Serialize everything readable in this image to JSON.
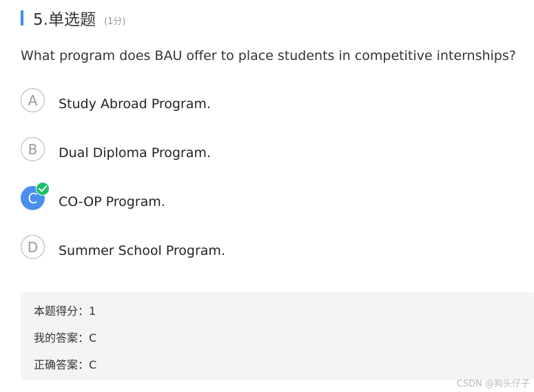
{
  "question": {
    "title": "5.单选题",
    "score_label": "(1分)",
    "stem": "What program does BAU offer to place students in competitive internships?"
  },
  "options": [
    {
      "letter": "A",
      "text": "Study Abroad Program.",
      "selected": false
    },
    {
      "letter": "B",
      "text": "Dual Diploma Program.",
      "selected": false
    },
    {
      "letter": "C",
      "text": "CO-OP Program.",
      "selected": true,
      "correct_badge_icon": "checkmark-icon"
    },
    {
      "letter": "D",
      "text": "Summer School Program.",
      "selected": false
    }
  ],
  "result": {
    "score_line": "本题得分：1",
    "my_answer_line": "我的答案：C",
    "correct_answer_line": "正确答案：C"
  },
  "watermark": "CSDN @狗头仔子",
  "colors": {
    "accent_bar": "#3a8ee6",
    "selected_option": "#4a8ef0",
    "correct_badge": "#1fbf6a",
    "result_panel_bg": "#f4f4f4"
  }
}
